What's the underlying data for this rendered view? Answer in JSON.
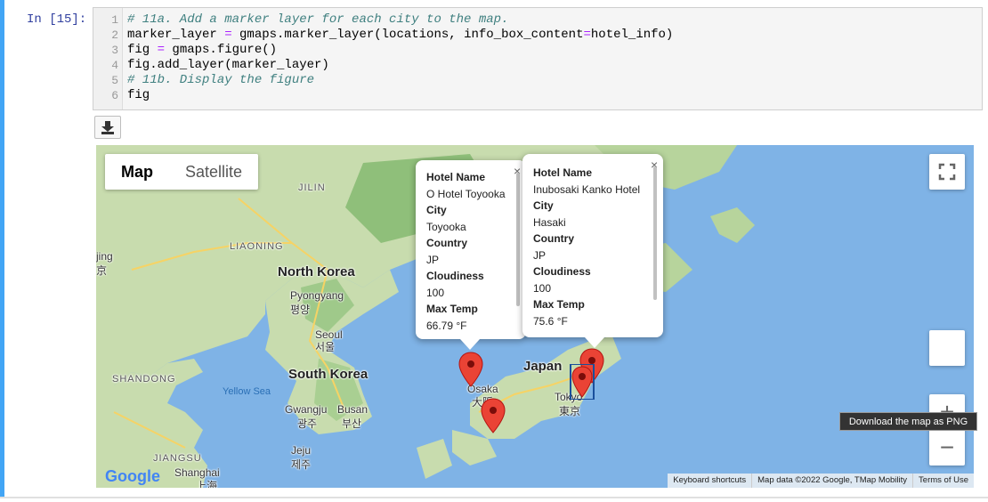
{
  "cell": {
    "prompt": "In [15]:",
    "line_numbers": [
      "1",
      "2",
      "3",
      "4",
      "5",
      "6"
    ],
    "lines": [
      {
        "comment": "# 11a. Add a marker layer for each city to the map."
      },
      {
        "a": "marker_layer ",
        "op1": "=",
        "b": " gmaps.marker_layer(locations, info_box_content",
        "op2": "=",
        "c": "hotel_info)"
      },
      {
        "a": "fig ",
        "op1": "=",
        "b": " gmaps.figure()"
      },
      {
        "a": "fig.add_layer(marker_layer)"
      },
      {
        "comment": "# 11b. Display the figure"
      },
      {
        "a": "fig"
      }
    ]
  },
  "download_button": {
    "icon": "download-icon",
    "tooltip": "Download the map as PNG"
  },
  "map": {
    "map_type": {
      "map": "Map",
      "satellite": "Satellite"
    },
    "labels": {
      "jilin": "JILIN",
      "liaoning": "LIAONING",
      "north_korea": "North Korea",
      "pyongyang": "Pyongyang",
      "pyongyang_local": "평양",
      "seoul": "Seoul",
      "seoul_local": "서울",
      "south_korea": "South Korea",
      "shandong": "SHANDONG",
      "yellow_sea": "Yellow Sea",
      "gwangju": "Gwangju",
      "gwangju_local": "광주",
      "busan": "Busan",
      "busan_local": "부산",
      "jeju": "Jeju",
      "jeju_local": "제주",
      "jiangsu": "JIANGSU",
      "shanghai": "Shanghai",
      "shanghai_local": "上海",
      "japan": "Japan",
      "osaka": "Osaka",
      "osaka_local": "大阪",
      "tokyo": "Tokyo",
      "tokyo_local": "東京",
      "beijing_partial": "jing",
      "beijing_local_partial": "京"
    },
    "info_windows": [
      {
        "hotel_name_label": "Hotel Name",
        "hotel_name": "O Hotel Toyooka",
        "city_label": "City",
        "city": "Toyooka",
        "country_label": "Country",
        "country": "JP",
        "cloudiness_label": "Cloudiness",
        "cloudiness": "100",
        "max_temp_label": "Max Temp",
        "max_temp": "66.79 °F"
      },
      {
        "hotel_name_label": "Hotel Name",
        "hotel_name": "Inubosaki Kanko Hotel",
        "city_label": "City",
        "city": "Hasaki",
        "country_label": "Country",
        "country": "JP",
        "cloudiness_label": "Cloudiness",
        "cloudiness": "100",
        "max_temp_label": "Max Temp",
        "max_temp": "75.6 °F"
      }
    ],
    "close_glyph": "×",
    "google_logo": "Google",
    "attribution": {
      "keyboard": "Keyboard shortcuts",
      "data": "Map data ©2022 Google, TMap Mobility",
      "terms": "Terms of Use"
    },
    "zoom_in_glyph": "+",
    "zoom_out_glyph": "−",
    "marker_color": "#ea4335"
  }
}
